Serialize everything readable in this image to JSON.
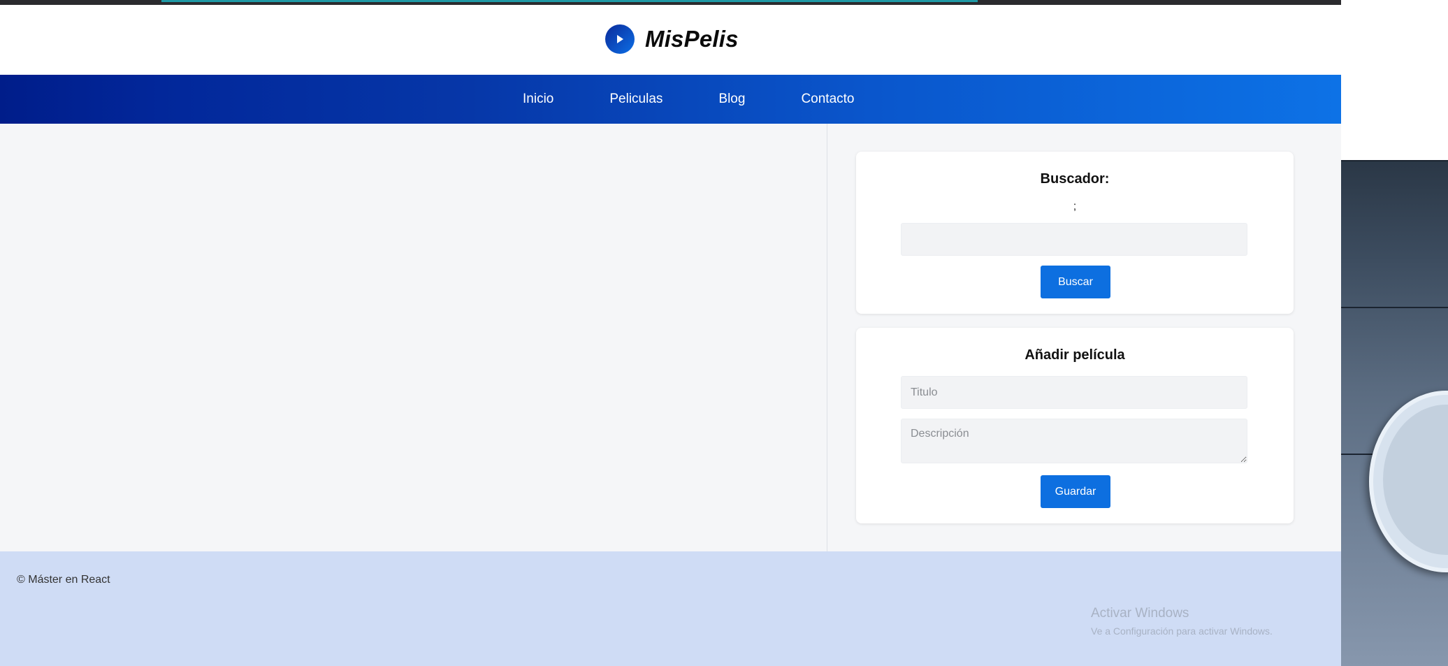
{
  "header": {
    "logo_text": "MisPelis",
    "logo_icon": "play-icon"
  },
  "nav": {
    "items": [
      {
        "label": "Inicio"
      },
      {
        "label": "Peliculas"
      },
      {
        "label": "Blog"
      },
      {
        "label": "Contacto"
      }
    ]
  },
  "sidebar": {
    "search": {
      "title": "Buscador:",
      "stray_text": ";",
      "input_value": "",
      "input_placeholder": "",
      "button_label": "Buscar"
    },
    "add_movie": {
      "title": "Añadir película",
      "title_placeholder": "Titulo",
      "description_placeholder": "Descripción",
      "button_label": "Guardar"
    }
  },
  "footer": {
    "copyright": "© Máster en React"
  },
  "windows_watermark": {
    "line1": "Activar Windows",
    "line2": "Ve a Configuración para activar Windows."
  },
  "colors": {
    "nav_gradient_start": "#001d8a",
    "nav_gradient_end": "#0d72e6",
    "button": "#0d6fe0",
    "footer_bg": "#cfdcf5",
    "content_bg": "#f5f6f8"
  }
}
